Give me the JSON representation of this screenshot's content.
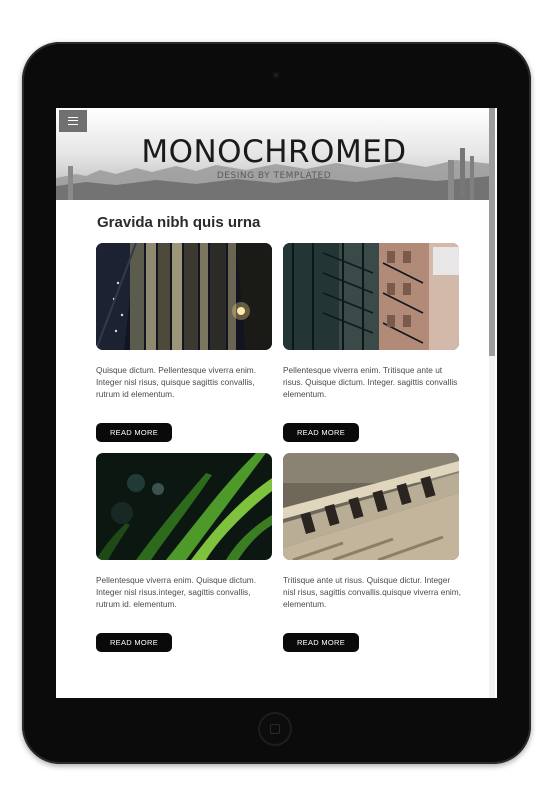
{
  "header": {
    "title": "MONOCHROMED",
    "subtitle": "DESING BY TEMPLATED",
    "menu_icon": "hamburger-menu-icon"
  },
  "main": {
    "section_title": "Gravida nibh quis urna",
    "cards": [
      {
        "image": "night-building-lights",
        "text": "Quisque dictum. Pellentesque viverra enim. Integer nisl risus, quisque sagittis convallis, rutrum id elementum.",
        "button": "READ MORE"
      },
      {
        "image": "city-fire-escapes",
        "text": "Pellentesque viverra enim. Tritisque ante ut risus. Quisque dictum. Integer. sagittis convallis elementum.",
        "button": "READ MORE"
      },
      {
        "image": "green-grass-closeup",
        "text": "Pellentesque viverra enim. Quisque dictum. Integer nisl risus.integer, sagittis convallis, rutrum id. elementum.",
        "button": "READ MORE"
      },
      {
        "image": "railway-tracks",
        "text": "Tritisque ante ut risus. Quisque dictur. Integer nisl risus, sagittis convallis.quisque viverra enim, elementum.",
        "button": "READ MORE"
      }
    ]
  }
}
